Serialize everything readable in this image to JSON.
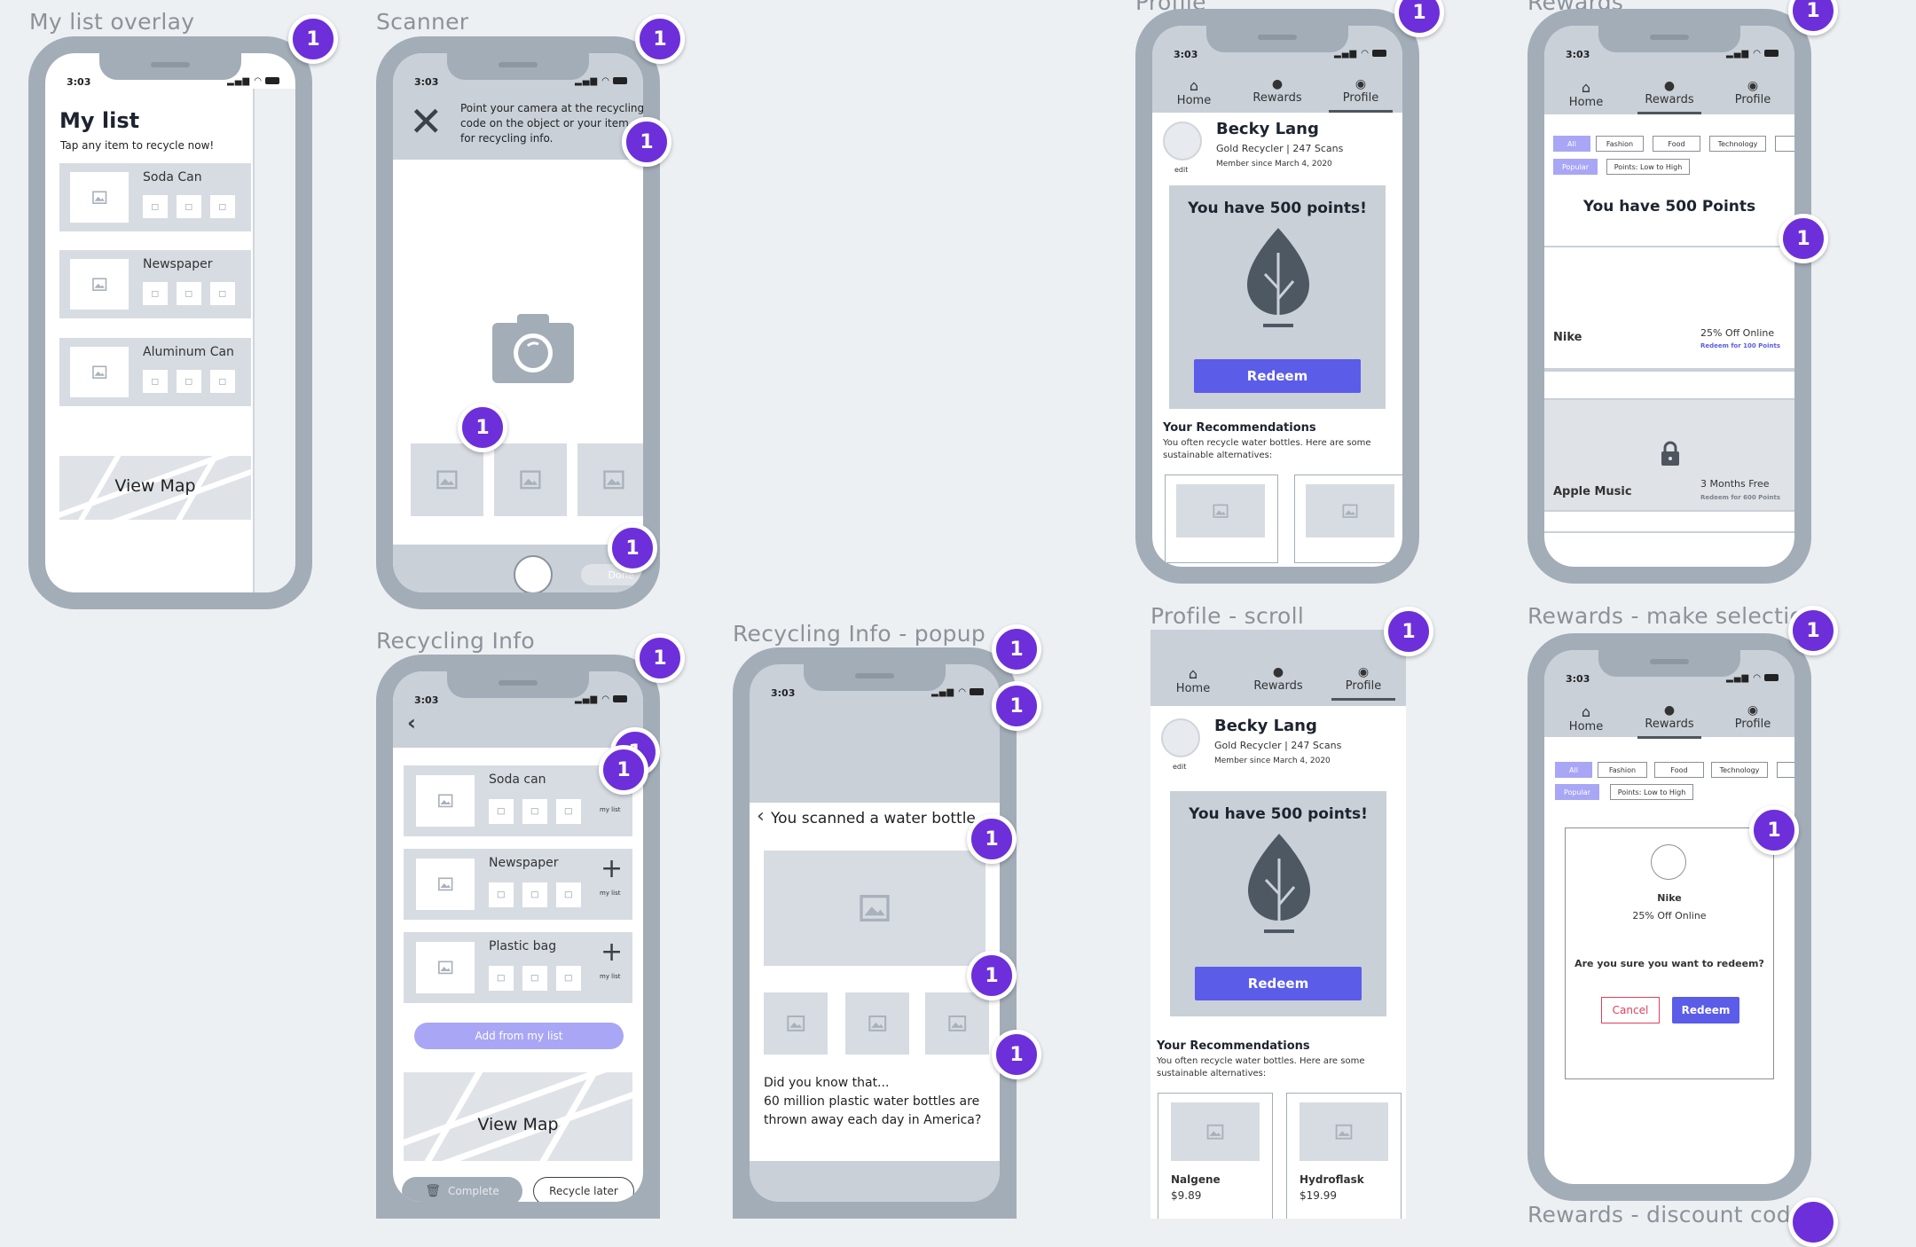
{
  "status_time": "3:03",
  "badge_label": "1",
  "frames": {
    "my_list": {
      "title": "My list overlay",
      "heading": "My list",
      "subheading": "Tap any item to recycle now!",
      "items": [
        "Soda Can",
        "Newspaper",
        "Aluminum Can"
      ],
      "map_label": "View Map"
    },
    "scanner": {
      "title": "Scanner",
      "instruction": "Point your camera at the recycling code on the object or your item for recycling info.",
      "done_label": "Done"
    },
    "recycling_info": {
      "title": "Recycling Info",
      "items": [
        {
          "name": "Soda can",
          "action": "my list"
        },
        {
          "name": "Newspaper",
          "action": "my list"
        },
        {
          "name": "Plastic bag",
          "action": "my list"
        }
      ],
      "add_button": "Add from my list",
      "map_label": "View Map",
      "complete_button": "Complete",
      "later_button": "Recycle later"
    },
    "popup": {
      "title": "Recycling Info - popup",
      "heading": "You scanned a water bottle",
      "fact": "Did you know that...\n60 million plastic water bottles are thrown away each day in America?"
    },
    "profile": {
      "title": "Profile",
      "nav": [
        "Home",
        "Rewards",
        "Profile"
      ],
      "name": "Becky Lang",
      "status": "Gold Recycler | 247 Scans",
      "member_since": "Member since March 4, 2020",
      "edit": "edit",
      "points_heading": "You have 500 points!",
      "redeem": "Redeem",
      "rec_heading": "Your Recommendations",
      "rec_text": "You often recycle water bottles. Here are some sustainable alternatives:"
    },
    "profile_scroll": {
      "title": "Profile - scroll",
      "products": [
        {
          "name": "Nalgene",
          "price": "$9.89"
        },
        {
          "name": "Hydroflask",
          "price": "$19.99"
        }
      ]
    },
    "rewards": {
      "title": "Rewards",
      "filters": [
        "All",
        "Fashion",
        "Food",
        "Technology"
      ],
      "sort_filters": [
        "Popular",
        "Points: Low to High"
      ],
      "points_heading": "You have 500 Points",
      "offers": [
        {
          "brand": "Nike",
          "deal": "25% Off Online",
          "redeem": "Redeem for 100 Points"
        },
        {
          "brand": "Apple Music",
          "deal": "3 Months Free",
          "redeem": "Redeem for 600 Points"
        }
      ]
    },
    "rewards_select": {
      "title": "Rewards - make selection",
      "brand": "Nike",
      "deal": "25% Off Online",
      "question": "Are you sure you want to redeem?",
      "cancel": "Cancel",
      "redeem": "Redeem"
    },
    "rewards_discount": {
      "title": "Rewards - discount code"
    }
  },
  "colors": {
    "badge": "#6d2fd9",
    "phone_frame": "#a3adb8",
    "primary_button": "#5b5ce8",
    "light_button": "#a9a6f5",
    "placeholder": "#d7dce2",
    "cancel_text": "#e0405a"
  }
}
